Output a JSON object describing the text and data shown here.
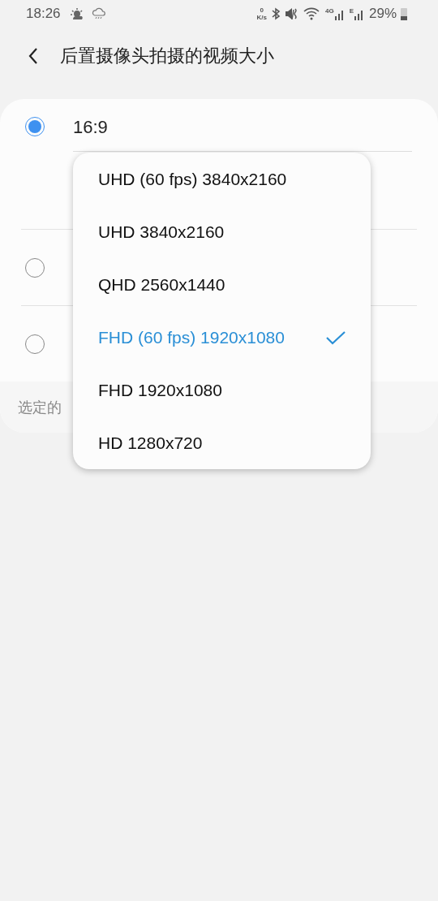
{
  "status_bar": {
    "time": "18:26",
    "net_speed_value": "0",
    "net_speed_unit": "K/s",
    "network_1": "4G",
    "network_2": "E",
    "battery": "29%"
  },
  "header": {
    "title": "后置摄像头拍摄的视频大小"
  },
  "options": [
    {
      "label": "16:9",
      "selected": true
    },
    {
      "selected": false
    },
    {
      "selected": false
    }
  ],
  "footer_text": "选定的",
  "dropdown": {
    "items": [
      {
        "label": "UHD (60 fps) 3840x2160",
        "selected": false
      },
      {
        "label": "UHD 3840x2160",
        "selected": false
      },
      {
        "label": "QHD 2560x1440",
        "selected": false
      },
      {
        "label": "FHD (60 fps) 1920x1080",
        "selected": true
      },
      {
        "label": "FHD 1920x1080",
        "selected": false
      },
      {
        "label": "HD 1280x720",
        "selected": false
      }
    ]
  }
}
